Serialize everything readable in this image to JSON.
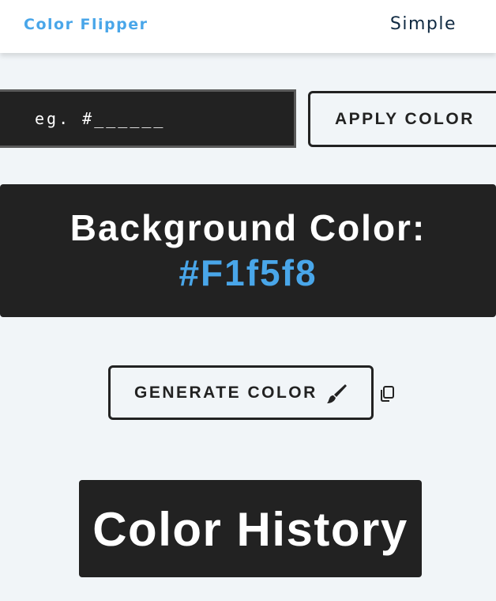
{
  "navbar": {
    "brand": "Color Flipper",
    "link": "Simple"
  },
  "color_input": {
    "placeholder": "eg. #______",
    "value": ""
  },
  "apply_button": {
    "label": "APPLY COLOR"
  },
  "color_display": {
    "title": "Background Color:",
    "value": "#F1f5f8"
  },
  "generate_button": {
    "label": "GENERATE COLOR",
    "icon": "paintbrush-icon"
  },
  "copy": {
    "icon": "copy-icon"
  },
  "history": {
    "title": "Color History"
  },
  "colors": {
    "background": "#f1f5f8",
    "brand": "#49a6e9",
    "dark": "#222222",
    "nav_text": "#102a42"
  }
}
